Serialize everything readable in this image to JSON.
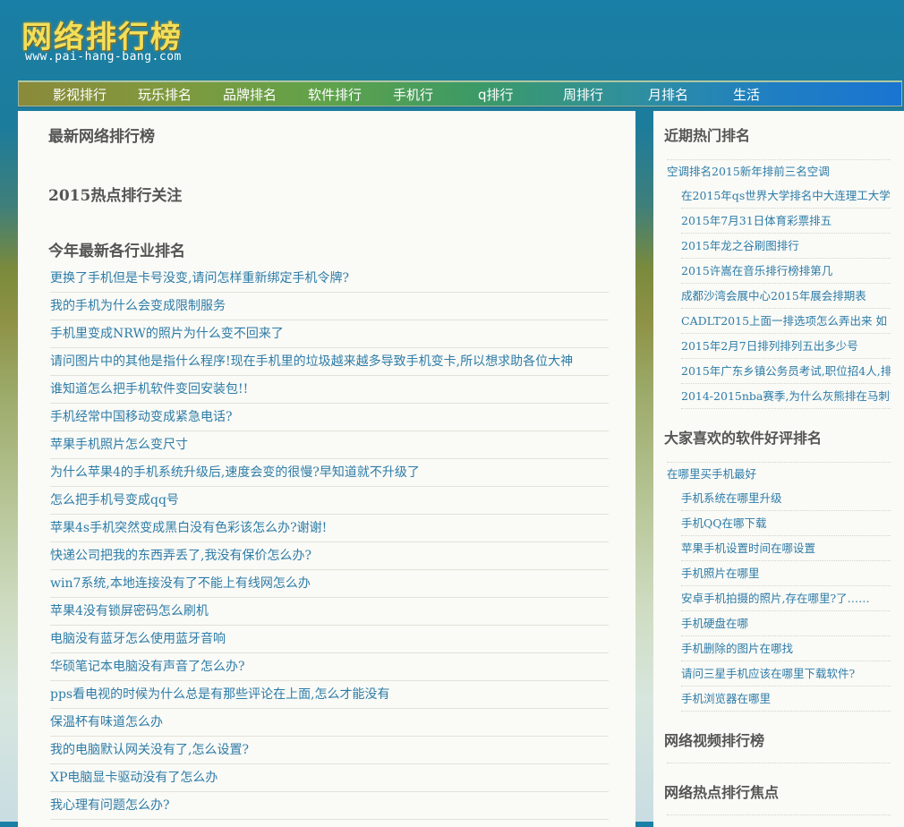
{
  "header": {
    "logo": "网络排行榜",
    "url": "www.pai-hang-bang.com"
  },
  "nav": [
    "影视排行",
    "玩乐排名",
    "品牌排名",
    "软件排行",
    "手机行",
    "q排行",
    "周排行",
    "月排名",
    "生活"
  ],
  "main": {
    "h1": "最新网络排行榜",
    "h2": "2015热点排行关注",
    "h3": "今年最新各行业排名",
    "items": [
      "更换了手机但是卡号没变,请问怎样重新绑定手机令牌?",
      "我的手机为什么会变成限制服务",
      "手机里变成NRW的照片为什么变不回来了",
      "请问图片中的其他是指什么程序!现在手机里的垃圾越来越多导致手机变卡,所以想求助各位大神",
      "谁知道怎么把手机软件变回安装包!!",
      "手机经常中国移动变成紧急电话?",
      "苹果手机照片怎么变尺寸",
      "为什么苹果4的手机系统升级后,速度会变的很慢?早知道就不升级了",
      "怎么把手机号变成qq号",
      "苹果4s手机突然变成黑白没有色彩该怎么办?谢谢!",
      "快递公司把我的东西弄丢了,我没有保价怎么办?",
      "win7系统,本地连接没有了不能上有线网怎么办",
      "苹果4没有锁屏密码怎么刷机",
      "电脑没有蓝牙怎么使用蓝牙音响",
      "华硕笔记本电脑没有声音了怎么办?",
      "pps看电视的时候为什么总是有那些评论在上面,怎么才能没有",
      "保温杯有味道怎么办",
      "我的电脑默认网关没有了,怎么设置?",
      "XP电脑显卡驱动没有了怎么办",
      "我心理有问题怎么办?"
    ]
  },
  "sidebar": {
    "s1": {
      "title": "近期热门排名",
      "first": "空调排名2015新年排前三名空调",
      "items": [
        "在2015年qs世界大学排名中大连理工大学",
        "2015年7月31日体育彩票排五",
        "2015年龙之谷刷图排行",
        "2015许嵩在音乐排行榜排第几",
        "成都沙湾会展中心2015年展会排期表",
        "CADLT2015上面一排选项怎么弄出来  如",
        "2015年2月7日排列排列五出多少号",
        "2015年广东乡镇公务员考试,职位招4人,排",
        "2014-2015nba赛季,为什么灰熊排在马刺前"
      ]
    },
    "s2": {
      "title": "大家喜欢的软件好评排名",
      "first": "在哪里买手机最好",
      "items": [
        "手机系统在哪里升级",
        "手机QQ在哪下载",
        "苹果手机设置时间在哪设置",
        "手机照片在哪里",
        "安卓手机拍摄的照片,存在哪里?了……",
        "手机硬盘在哪",
        "手机删除的图片在哪找",
        "请问三星手机应该在哪里下载软件?",
        "手机浏览器在哪里"
      ]
    },
    "s3": {
      "title": "网络视频排行榜"
    },
    "s4": {
      "title": "网络热点排行焦点"
    }
  }
}
